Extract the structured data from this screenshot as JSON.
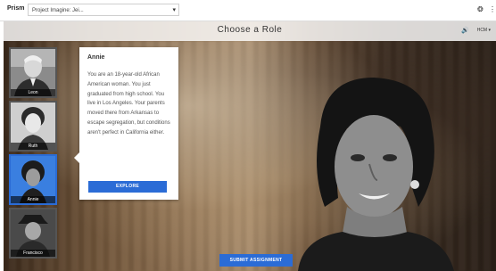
{
  "topbar": {
    "brand": "Prism",
    "project_select_value": "Project Imagine: Jei...",
    "icons": [
      "chevron-down-icon",
      "pin-icon",
      "more-icon"
    ]
  },
  "header": {
    "title": "Choose a Role",
    "audio_icon": "speaker-icon",
    "language_label": "HCM ▾"
  },
  "roles": [
    {
      "name": "Leon",
      "active": false
    },
    {
      "name": "Ruth",
      "active": false
    },
    {
      "name": "Annie",
      "active": true
    },
    {
      "name": "Francisco",
      "active": false
    }
  ],
  "card": {
    "title": "Annie",
    "body": "You are an 18-year-old African American woman. You just graduated from high school. You live in Los Angeles. Your parents moved there from Arkansas to escape segregation, but conditions aren't perfect in California either.",
    "button_label": "EXPLORE"
  },
  "footer": {
    "submit_label": "SUBMIT ASSIGNMENT"
  },
  "colors": {
    "accent": "#2b6cd6"
  }
}
